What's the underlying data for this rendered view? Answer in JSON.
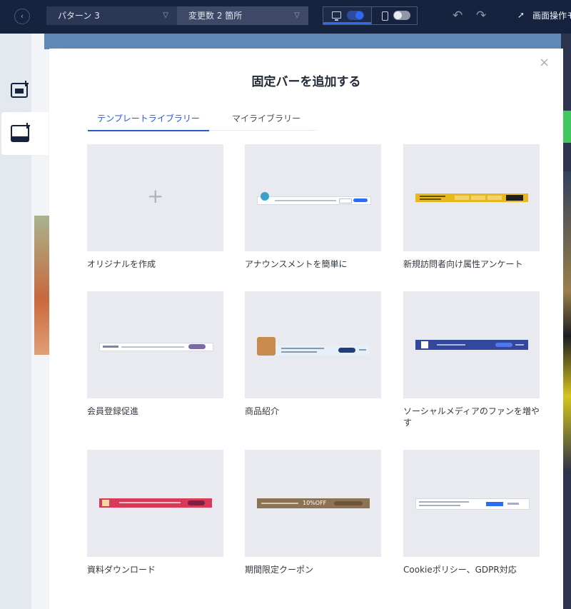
{
  "topbar": {
    "pattern_select": "パターン 3",
    "variable_select": "変更数 2 箇所",
    "screen_operation_label": "画面操作モ"
  },
  "modal": {
    "title": "固定バーを追加する",
    "close_symbol": "×",
    "tabs": [
      {
        "label": "テンプレートライブラリー",
        "active": true
      },
      {
        "label": "マイライブラリー",
        "active": false
      }
    ],
    "templates": [
      {
        "label": "オリジナルを作成",
        "thumbnail": "plus-icon"
      },
      {
        "label": "アナウンスメントを簡単に",
        "bar_color": "#ffffff"
      },
      {
        "label": "新規訪問者向け属性アンケート",
        "bar_color": "#e8b81f"
      },
      {
        "label": "会員登録促進",
        "bar_color": "#ffffff"
      },
      {
        "label": "商品紹介",
        "bar_color": "#e6f0f8"
      },
      {
        "label": "ソーシャルメディアのファンを増やす",
        "bar_color": "#33489c"
      },
      {
        "label": "資料ダウンロード",
        "bar_color": "#d93a5a"
      },
      {
        "label": "期間限定クーポン",
        "bar_color": "#8c7355",
        "bar_text": "10%OFF"
      },
      {
        "label": "Cookieポリシー、GDPR対応",
        "bar_color": "#ffffff"
      }
    ]
  },
  "colors": {
    "topbar_bg": "#16233f",
    "accent": "#2b56d6",
    "thumb_bg": "#e8eaef"
  }
}
